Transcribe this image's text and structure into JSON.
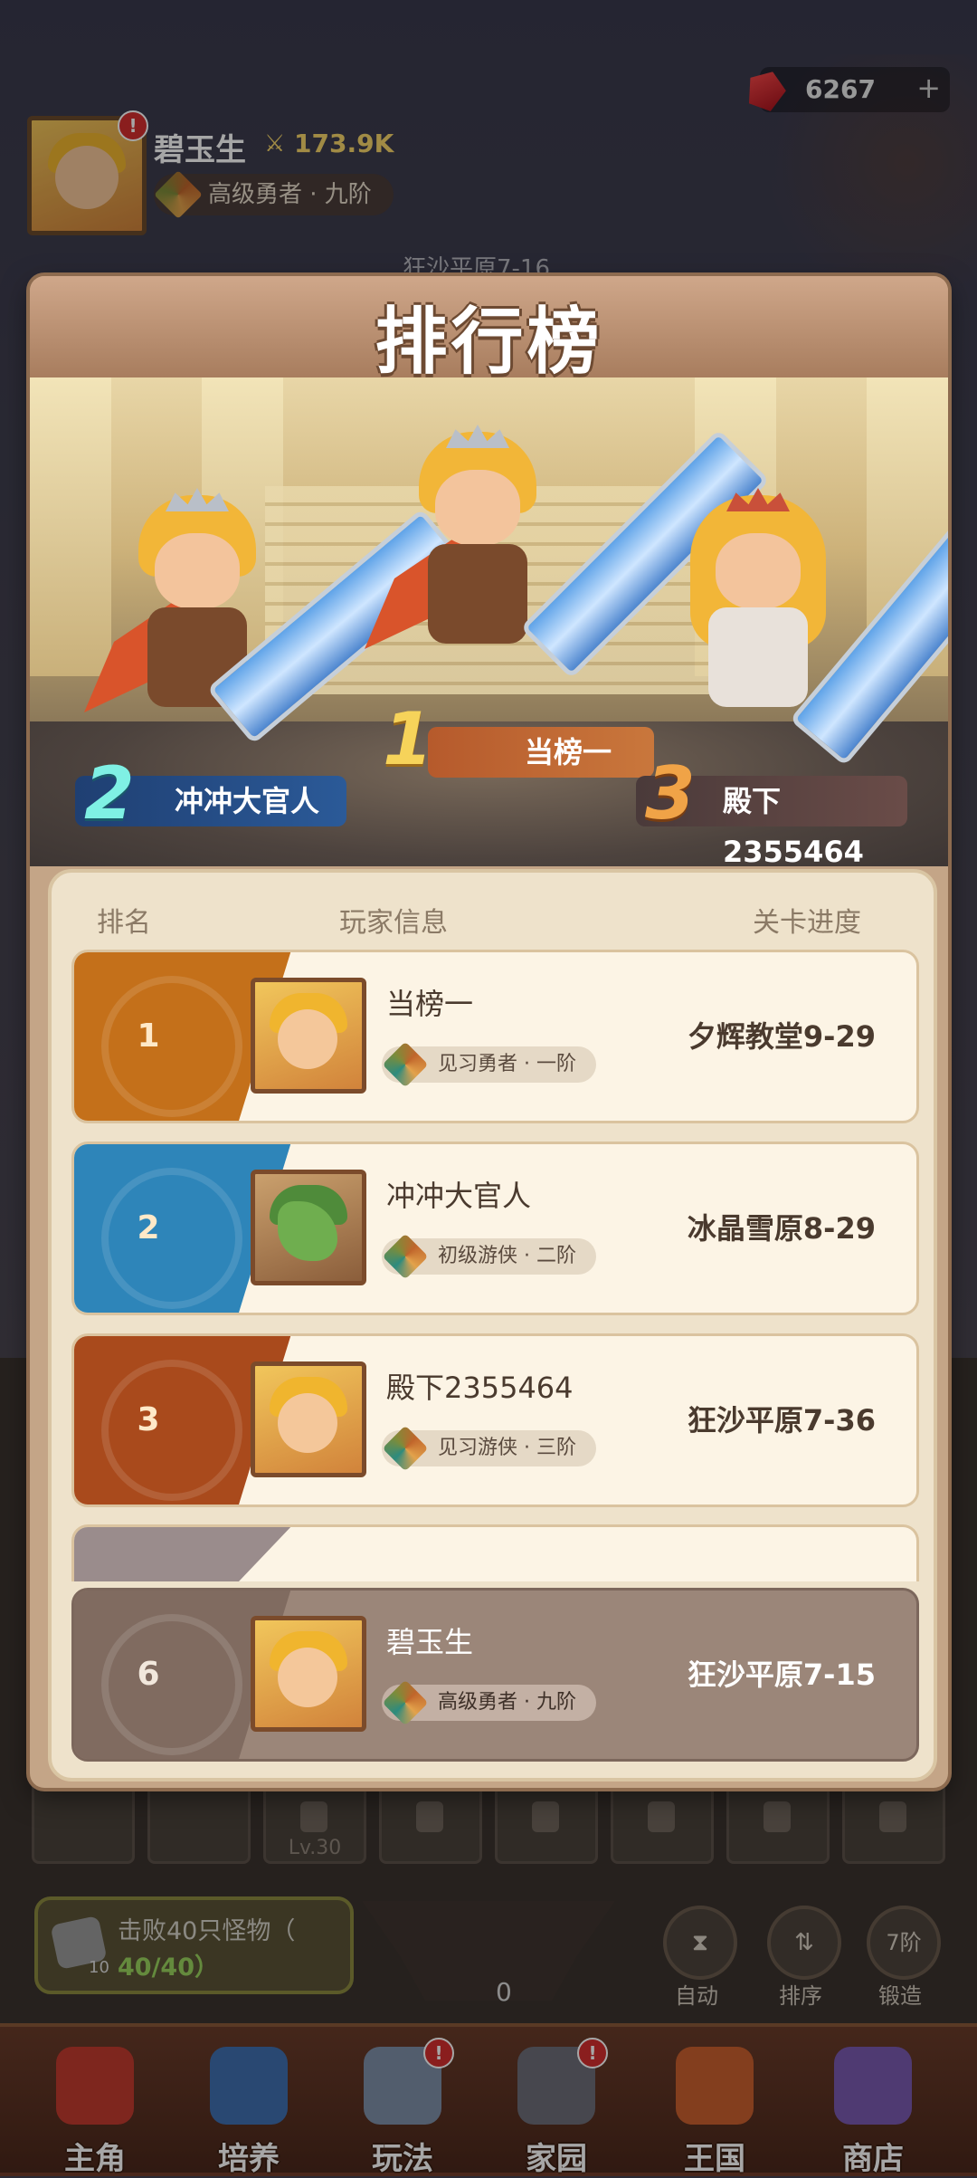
{
  "hud": {
    "player_name": "碧玉生",
    "power": "173.9K",
    "title": "高级勇者 · 九阶",
    "gems": "6267",
    "gems_plus": "+",
    "stage": "狂沙平原7-16"
  },
  "leaderboard": {
    "title": "排行榜",
    "podium": [
      {
        "rank": "1",
        "name": "当榜一"
      },
      {
        "rank": "2",
        "name": "冲冲大官人"
      },
      {
        "rank": "3",
        "name": "殿下2355464"
      }
    ],
    "columns": {
      "rank": "排名",
      "player": "玩家信息",
      "progress": "关卡进度"
    },
    "rows": [
      {
        "rank": "1",
        "name": "当榜一",
        "title": "见习勇者 · 一阶",
        "stage": "夕辉教堂9-29",
        "color": "#c4701a"
      },
      {
        "rank": "2",
        "name": "冲冲大官人",
        "title": "初级游侠 · 二阶",
        "stage": "冰晶雪原8-29",
        "color": "#2e85b9"
      },
      {
        "rank": "3",
        "name": "殿下2355464",
        "title": "见习游侠 · 三阶",
        "stage": "狂沙平原7-36",
        "color": "#a94a1c"
      }
    ],
    "me": {
      "rank": "6",
      "name": "碧玉生",
      "title": "高级勇者 · 九阶",
      "stage": "狂沙平原7-15"
    }
  },
  "bottom": {
    "slot_level": "Lv.30",
    "quest_text": "击败40只怪物（",
    "quest_progress": "40/40）",
    "quest_count": "10",
    "anvil_count": "0",
    "buttons": [
      {
        "label": "自动",
        "glyph": "⧗"
      },
      {
        "label": "排序",
        "glyph": "⇅"
      },
      {
        "label": "锻造",
        "glyph": "7阶"
      }
    ]
  },
  "nav": [
    {
      "label": "主角",
      "color": "#c23b2f"
    },
    {
      "label": "培养",
      "color": "#3f6fb0"
    },
    {
      "label": "玩法",
      "color": "#7f8fa8"
    },
    {
      "label": "家园",
      "color": "#6e6e78"
    },
    {
      "label": "王国",
      "color": "#c9602e"
    },
    {
      "label": "商店",
      "color": "#7a5ab0"
    }
  ]
}
